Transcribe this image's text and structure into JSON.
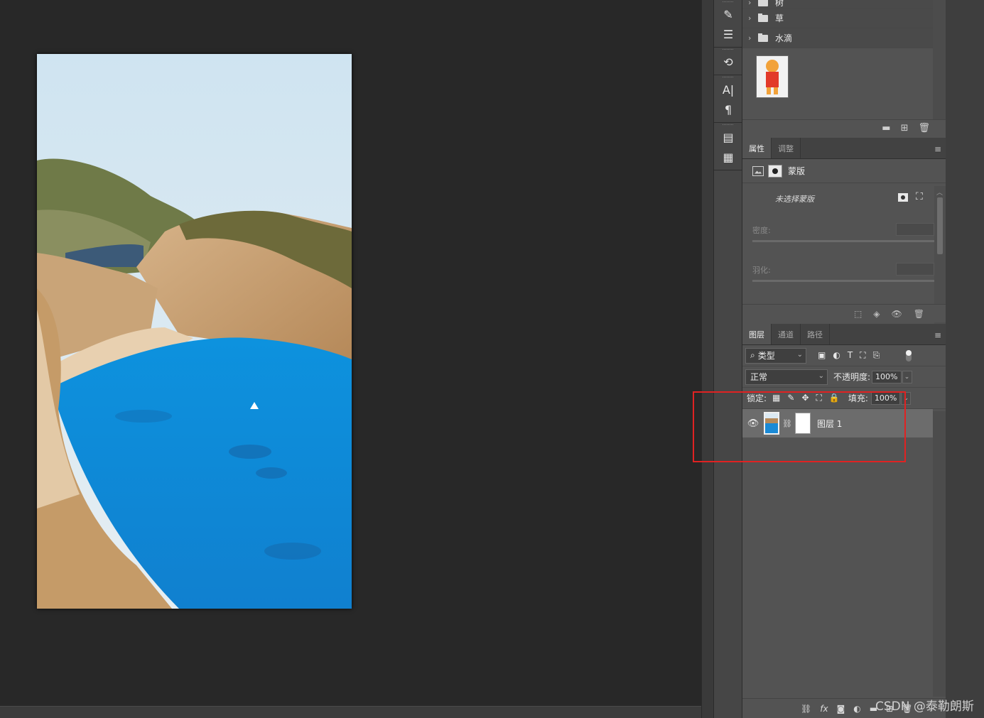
{
  "layer_groups": [
    {
      "name": "树",
      "expanded": false
    },
    {
      "name": "草",
      "expanded": false
    },
    {
      "name": "水滴",
      "expanded": false
    }
  ],
  "properties": {
    "tabs": [
      {
        "label": "属性",
        "active": true
      },
      {
        "label": "调整",
        "active": false
      }
    ],
    "mask_title": "蒙版",
    "no_mask_text": "未选择蒙版",
    "density_label": "密度:",
    "feather_label": "羽化:"
  },
  "layers": {
    "tabs": [
      {
        "label": "图层",
        "active": true
      },
      {
        "label": "通道",
        "active": false
      },
      {
        "label": "路径",
        "active": false
      }
    ],
    "filter_kind": "类型",
    "blend_mode": "正常",
    "opacity_label": "不透明度:",
    "opacity_value": "100%",
    "lock_label": "锁定:",
    "fill_label": "填充:",
    "fill_value": "100%",
    "items": [
      {
        "name": "图层 1",
        "visible": true,
        "has_mask": true,
        "selected": true
      }
    ]
  },
  "tools": [
    [
      "brush-preset-icon",
      "adjust-icon"
    ],
    [
      "history-icon"
    ],
    [
      "character-icon",
      "paragraph-icon"
    ],
    [
      "properties-icon",
      "notes-icon"
    ]
  ],
  "watermark": "CSDN @泰勒朗斯",
  "colors": {
    "canvas_bg": "#282828",
    "panel_bg": "#535353",
    "highlight": "#e02222",
    "sea": "#0a90dc"
  }
}
